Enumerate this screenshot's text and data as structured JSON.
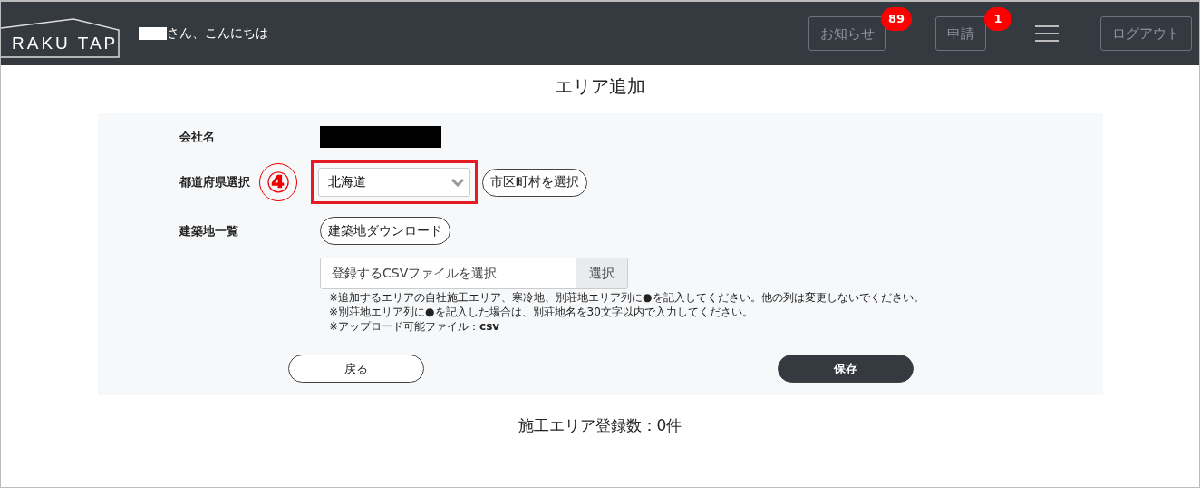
{
  "header": {
    "logo": "RAKU TAP",
    "greeting": "さん、こんにちは",
    "notices": {
      "label": "お知らせ",
      "badge": "89"
    },
    "requests": {
      "label": "申請",
      "badge": "1"
    },
    "logout": "ログアウト"
  },
  "page_title": "エリア追加",
  "form": {
    "company_label": "会社名",
    "prefecture_label": "都道府県選択",
    "annotation": "④",
    "prefecture_value": "北海道",
    "city_button": "市区町村を選択",
    "sites_label": "建築地一覧",
    "download_button": "建築地ダウンロード",
    "file_placeholder": "登録するCSVファイルを選択",
    "file_button": "選択",
    "notes": [
      "※追加するエリアの自社施工エリア、寒冷地、別荘地エリア列に●を記入してください。他の列は変更しないでください。",
      "※別荘地エリア列に●を記入した場合は、別荘地名を30文字以内で入力してください。",
      "※アップロード可能ファイル：**csv**"
    ],
    "back_button": "戻る",
    "save_button": "保存"
  },
  "summary": "施工エリア登録数：0件"
}
